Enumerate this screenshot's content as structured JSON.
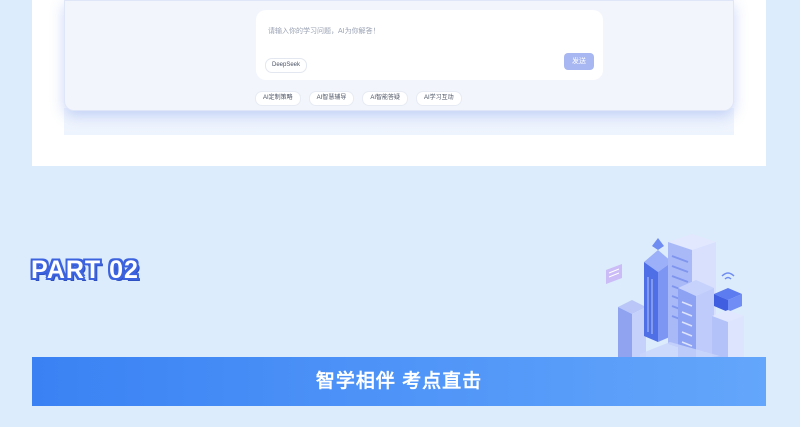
{
  "chat": {
    "placeholder": "请输入你的学习问题，AI为你解答！",
    "model_label": "DeepSeek",
    "send_label": "发送",
    "suggestions": [
      "AI定制策略",
      "AI智慧辅导",
      "AI智能答疑",
      "AI学习互动"
    ]
  },
  "section": {
    "part_label": "PART 02",
    "banner_title": "智学相伴 考点直击"
  },
  "icons": {
    "illustration": "isometric-city-illustration"
  },
  "colors": {
    "page_bg": "#dcecfc",
    "banner_start": "#3a82f4",
    "banner_end": "#63a6fb",
    "send_button": "#a8b7f1",
    "part_outline": "#3d63df"
  }
}
